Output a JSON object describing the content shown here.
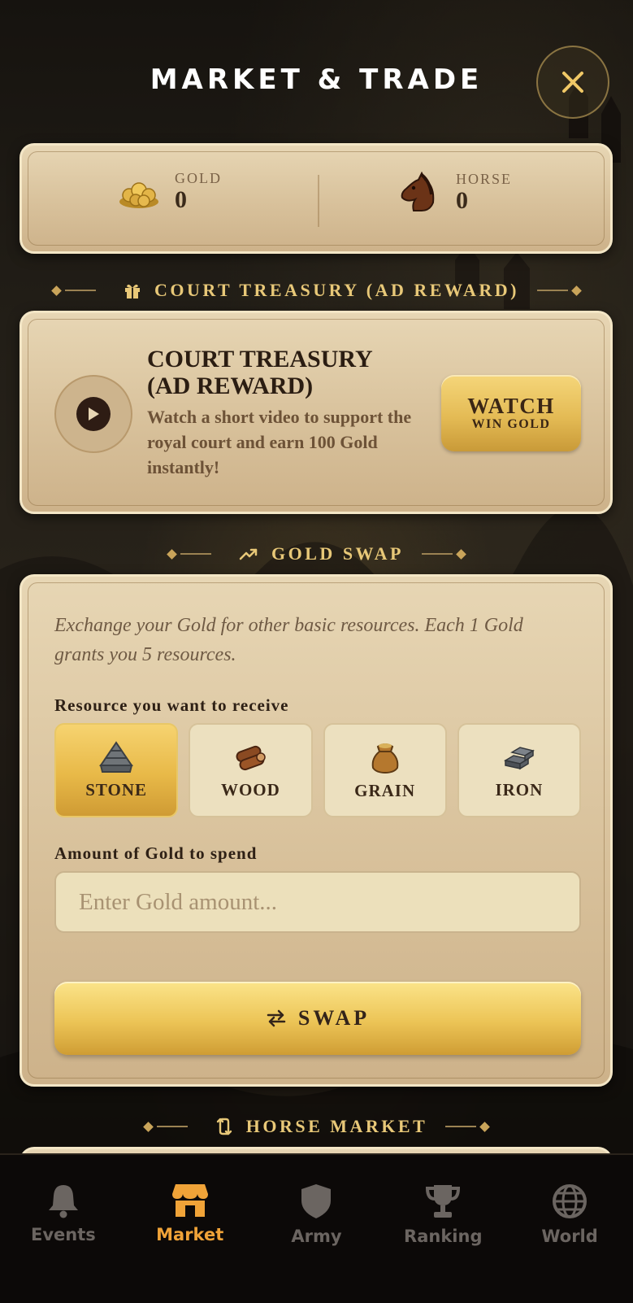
{
  "header": {
    "title": "MARKET & TRADE",
    "close_icon": "close-icon"
  },
  "resources": {
    "gold": {
      "label": "GOLD",
      "value": "0",
      "icon": "gold-coins-icon"
    },
    "horse": {
      "label": "HORSE",
      "value": "0",
      "icon": "horse-head-icon"
    }
  },
  "ad_section": {
    "heading": "COURT TREASURY (AD REWARD)",
    "title": "COURT TREASURY (AD REWARD)",
    "description": "Watch a short video to support the royal court and earn 100 Gold instantly!",
    "button_main": "WATCH",
    "button_sub": "WIN GOLD"
  },
  "swap_section": {
    "heading": "GOLD SWAP",
    "description": "Exchange your Gold for other basic resources. Each 1 Gold grants you 5 resources.",
    "resource_label": "Resource you want to receive",
    "options": [
      {
        "label": "STONE",
        "icon": "stone-icon",
        "selected": true
      },
      {
        "label": "WOOD",
        "icon": "wood-icon",
        "selected": false
      },
      {
        "label": "GRAIN",
        "icon": "grain-sack-icon",
        "selected": false
      },
      {
        "label": "IRON",
        "icon": "iron-ingot-icon",
        "selected": false
      }
    ],
    "amount_label": "Amount of Gold to spend",
    "amount_placeholder": "Enter Gold amount...",
    "amount_value": "",
    "swap_button": "SWAP"
  },
  "horse_section": {
    "heading": "HORSE MARKET"
  },
  "nav": {
    "items": [
      {
        "label": "Events",
        "icon": "bell-icon",
        "active": false
      },
      {
        "label": "Market",
        "icon": "shop-icon",
        "active": true
      },
      {
        "label": "Army",
        "icon": "shield-icon",
        "active": false
      },
      {
        "label": "Ranking",
        "icon": "trophy-icon",
        "active": false
      },
      {
        "label": "World",
        "icon": "globe-icon",
        "active": false
      }
    ]
  },
  "colors": {
    "accent_gold": "#e8b948",
    "active_nav": "#f0a338",
    "panel": "#d8c19b"
  }
}
